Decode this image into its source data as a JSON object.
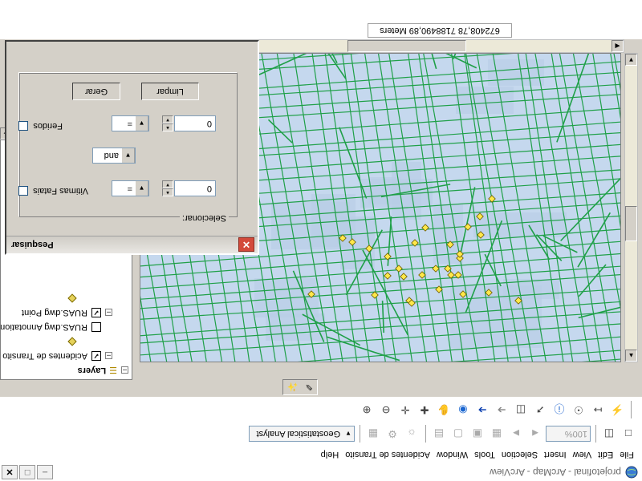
{
  "window": {
    "title": "projetofinal - ArcMap - ArcView",
    "controls": {
      "minimize": "–",
      "maximize": "□",
      "close": "✕"
    }
  },
  "menu": [
    "File",
    "Edit",
    "View",
    "Insert",
    "Selection",
    "Tools",
    "Window",
    "Acidentes de Transito",
    "Help"
  ],
  "toolbars": {
    "standard_icons": [
      "new-document",
      "open-folder",
      "save",
      "print",
      "cut",
      "copy",
      "paste",
      "delete",
      "undo",
      "redo",
      "add-data"
    ],
    "zoom_combo": "100%",
    "geostatistical_label": "Geostatistical Analyst",
    "tools_icons": [
      "zoom-in",
      "zoom-out",
      "fixed-zoom-in",
      "fixed-zoom-out",
      "pan",
      "full-extent",
      "back-extent",
      "forward-extent",
      "select-features",
      "select-elements",
      "identify",
      "find",
      "measure",
      "hyperlink"
    ],
    "small_icons": [
      "editor-icon",
      "arcscene-icon"
    ]
  },
  "toc": {
    "items": [
      {
        "label": "Layers",
        "bold": true
      },
      {
        "label": "Acidentes de Transito",
        "checked": true
      },
      {
        "label": "RUAS.dwg Annotation",
        "checked": false
      },
      {
        "label": "RUAS.dwg Point",
        "checked": true
      }
    ]
  },
  "status": {
    "coordinates": "672408,78  7188490,89 Meters"
  },
  "colors": {
    "roads": "#1fa048",
    "map_bg": "#c5d8ee",
    "points": "#ffe84a",
    "close_red": "#d34a3b"
  },
  "pesquisar": {
    "title": "Pesquisar",
    "group_label": "Selecionar:",
    "vitimas_label": "Vitimas Fatais",
    "vitimas_operator": "=",
    "vitimas_value": "0",
    "logic_operator": "and",
    "feridos_label": "Feridos",
    "feridos_operator": "=",
    "feridos_value": "0",
    "gerar_label": "Gerar",
    "limpar_label": "Limpar"
  },
  "map": {
    "accident_points": 27
  }
}
